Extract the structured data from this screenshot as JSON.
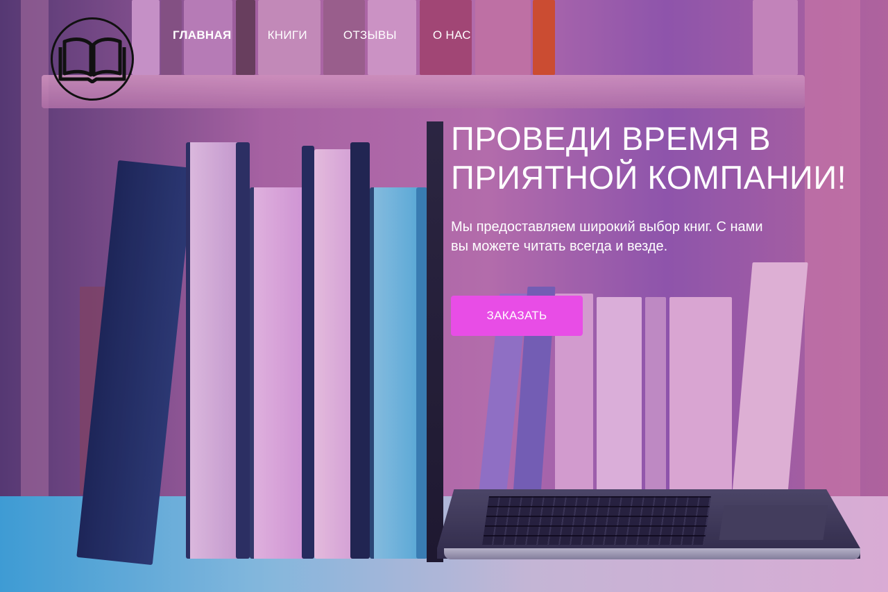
{
  "logo": {
    "icon": "open-book-icon"
  },
  "nav": {
    "items": [
      {
        "label": "ГЛАВНАЯ",
        "active": true
      },
      {
        "label": "КНИГИ",
        "active": false
      },
      {
        "label": "ОТЗЫВЫ",
        "active": false
      },
      {
        "label": "О НАС",
        "active": false
      }
    ]
  },
  "hero": {
    "headline_line1": "ПРОВЕДИ ВРЕМЯ В",
    "headline_line2": "ПРИЯТНОЙ КОМПАНИИ!",
    "subtext_line1": "Мы предоставляем широкий выбор книг. С нами",
    "subtext_line2": "вы можете читать всегда и везде.",
    "cta_label": "ЗАКАЗАТЬ"
  },
  "colors": {
    "accent": "#e84de6",
    "text": "#ffffff",
    "logo_outline": "#111111"
  }
}
